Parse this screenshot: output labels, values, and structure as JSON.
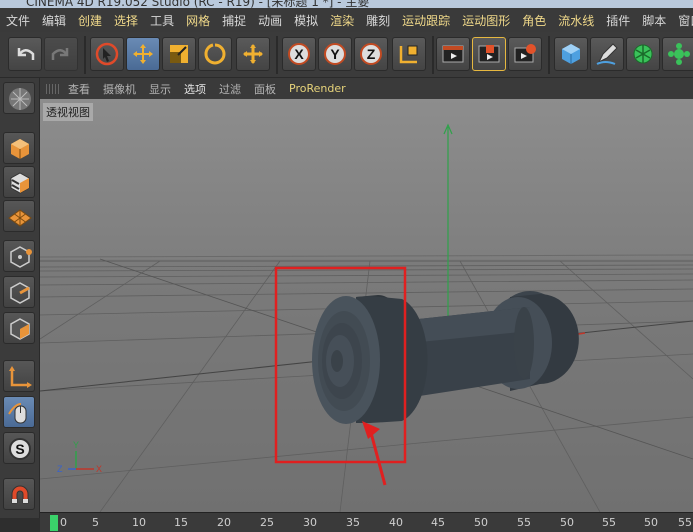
{
  "window": {
    "title": "CINEMA 4D R19.052 Studio (RC - R19) - [未标题 1 *] - 主要"
  },
  "menubar": {
    "items": [
      "文件",
      "编辑",
      "创建",
      "选择",
      "工具",
      "网格",
      "捕捉",
      "动画",
      "模拟",
      "渲染",
      "雕刻",
      "运动跟踪",
      "运动图形",
      "角色",
      "流水线",
      "插件",
      "脚本",
      "窗口"
    ]
  },
  "toolbar": {
    "buttons": [
      "undo-icon",
      "redo-icon",
      "live-select-icon",
      "move-icon",
      "scale-icon",
      "rotate-icon",
      "move-add-icon",
      "x-axis-icon",
      "y-axis-icon",
      "z-axis-icon",
      "world-coord-icon",
      "render-view-icon",
      "render-picture-icon",
      "render-settings-icon",
      "cube-icon",
      "pen-icon",
      "subdivision-icon"
    ],
    "axis_labels": {
      "x": "X",
      "y": "Y",
      "z": "Z"
    }
  },
  "viewport_menu": {
    "items": [
      "查看",
      "摄像机",
      "显示",
      "选项",
      "过滤",
      "面板",
      "ProRender"
    ],
    "active": "选项"
  },
  "viewport": {
    "label": "透视视图",
    "axis": {
      "x": "X",
      "y": "Y",
      "z": "Z"
    }
  },
  "left_toolbar": {
    "buttons": [
      "make-editable-icon",
      "model-mode-icon",
      "texture-mode-icon",
      "workplane-icon",
      "points-mode-icon",
      "edges-mode-icon",
      "polygons-mode-icon",
      "axis-mode-icon",
      "tweak-icon",
      "snap-icon",
      "magnet-icon"
    ]
  },
  "timeline": {
    "ticks": [
      "0",
      "5",
      "10",
      "15",
      "20",
      "25",
      "30",
      "35",
      "40",
      "45",
      "50",
      "55",
      "50",
      "55",
      "50",
      "55"
    ]
  },
  "colors": {
    "accent": "#e6d37a",
    "highlight_box": "#e02020",
    "timeline_marker": "#3ad26a"
  }
}
